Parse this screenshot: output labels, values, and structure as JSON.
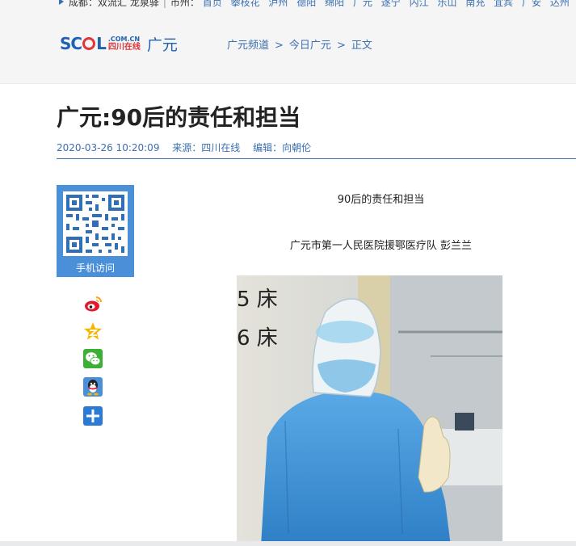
{
  "city_nav": {
    "prefix": "成都：双流汇 龙泉驿",
    "label": "市州：",
    "cities": [
      "首页",
      "攀枝花",
      "泸州",
      "德阳",
      "绵阳",
      "广元",
      "遂宁",
      "内江",
      "乐山",
      "南充",
      "宜宾",
      "广安",
      "达州"
    ]
  },
  "logo": {
    "brand": "SCOL",
    "domain": ".COM.CN",
    "sub": "四川在线",
    "region": "广元"
  },
  "breadcrumb": [
    "广元频道",
    "今日广元",
    "正文"
  ],
  "article": {
    "title": "广元:90后的责任和担当",
    "date": "2020-03-26 10:20:09",
    "source": "来源：四川在线",
    "editor": "编辑：向朝伦",
    "subtitle": "90后的责任和担当",
    "author_line": "广元市第一人民医院援鄂医疗队 彭兰兰",
    "photo_text_1": "5 床",
    "photo_text_2": "6 床"
  },
  "sidebar": {
    "qr_label": "手机访问"
  },
  "colors": {
    "link": "#3b6fb0",
    "brand_red": "#e0353a",
    "brand_blue": "#1f62b3"
  }
}
